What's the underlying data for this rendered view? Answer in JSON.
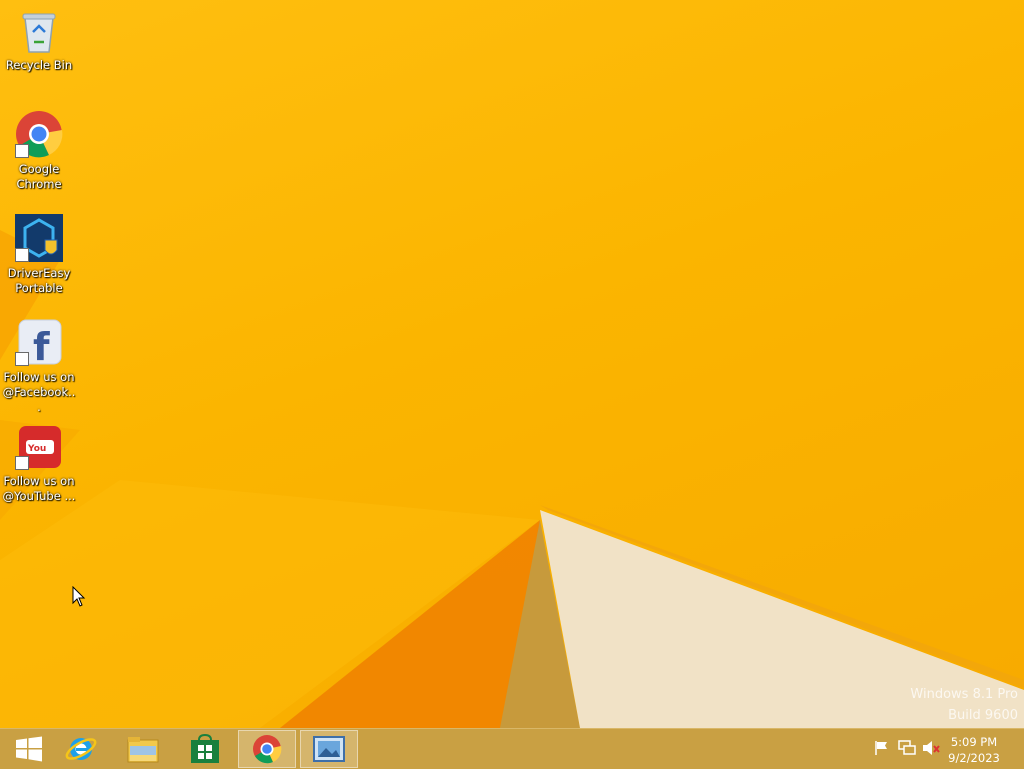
{
  "desktop_icons": [
    {
      "name": "recycle-bin",
      "label": "Recycle Bin"
    },
    {
      "name": "google-chrome",
      "label": "Google Chrome"
    },
    {
      "name": "drivereasy-portable",
      "label": "DriverEasy Portable"
    },
    {
      "name": "facebook-shortcut",
      "label": "Follow us on @Facebook..."
    },
    {
      "name": "youtube-shortcut",
      "label": "Follow us on @YouTube ..."
    }
  ],
  "watermark": {
    "line1": "Windows 8.1 Pro",
    "line2": "Build 9600"
  },
  "taskbar": {
    "items": [
      {
        "icon": "start-icon"
      },
      {
        "icon": "internet-explorer-icon"
      },
      {
        "icon": "file-explorer-icon"
      },
      {
        "icon": "store-icon"
      },
      {
        "icon": "chrome-icon",
        "active": true
      },
      {
        "icon": "photos-icon",
        "active": true
      }
    ],
    "tray": [
      "flag-icon",
      "network-icon",
      "volume-muted-icon"
    ],
    "clock": {
      "time": "5:09 PM",
      "date": "9/2/2023"
    }
  },
  "colors": {
    "accent": "#f8b200",
    "taskbar": "#c9a043"
  }
}
